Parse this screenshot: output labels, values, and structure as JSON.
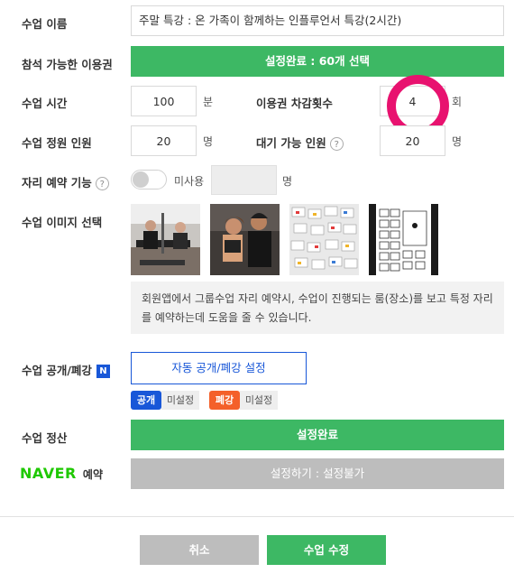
{
  "class_name": {
    "label": "수업 이름",
    "value": "주말 특강 : 온 가족이 함께하는 인플루언서 특강(2시간)"
  },
  "passes": {
    "label": "참석 가능한 이용권",
    "button": "설정완료 : 60개 선택"
  },
  "class_time": {
    "label": "수업 시간",
    "value": "100",
    "unit": "분"
  },
  "deduct": {
    "label": "이용권 차감횟수",
    "value": "4",
    "unit": "회"
  },
  "capacity": {
    "label": "수업 정원 인원",
    "value": "20",
    "unit": "명"
  },
  "waiting": {
    "label": "대기 가능 인원",
    "value": "20",
    "unit": "명",
    "help": "?"
  },
  "seat": {
    "label": "자리 예약 기능",
    "help": "?",
    "toggle_text": "미사용",
    "unit": "명"
  },
  "image": {
    "label": "수업 이미지 선택",
    "description": "회원앱에서 그룹수업 자리 예약시, 수업이 진행되는 룸(장소)를 보고 특정 자리를 예약하는데 도움을 줄 수 있습니다."
  },
  "visibility": {
    "label": "수업 공개/폐강",
    "badge": "N",
    "button": "자동 공개/폐강 설정",
    "open_tag": "공개",
    "open_status": "미설정",
    "close_tag": "폐강",
    "close_status": "미설정"
  },
  "settlement": {
    "label": "수업 정산",
    "button": "설정완료"
  },
  "naver": {
    "logo": "NAVER",
    "suffix": "예약",
    "button": "설정하기 : 설정불가"
  },
  "footer": {
    "cancel": "취소",
    "submit": "수업 수정"
  },
  "colors": {
    "green": "#3db864",
    "gray_button": "#bdbdbd",
    "blue_tag": "#1857d8",
    "orange_tag": "#f4602a",
    "highlight_ring": "#e8126f",
    "naver_green": "#1ec800"
  }
}
